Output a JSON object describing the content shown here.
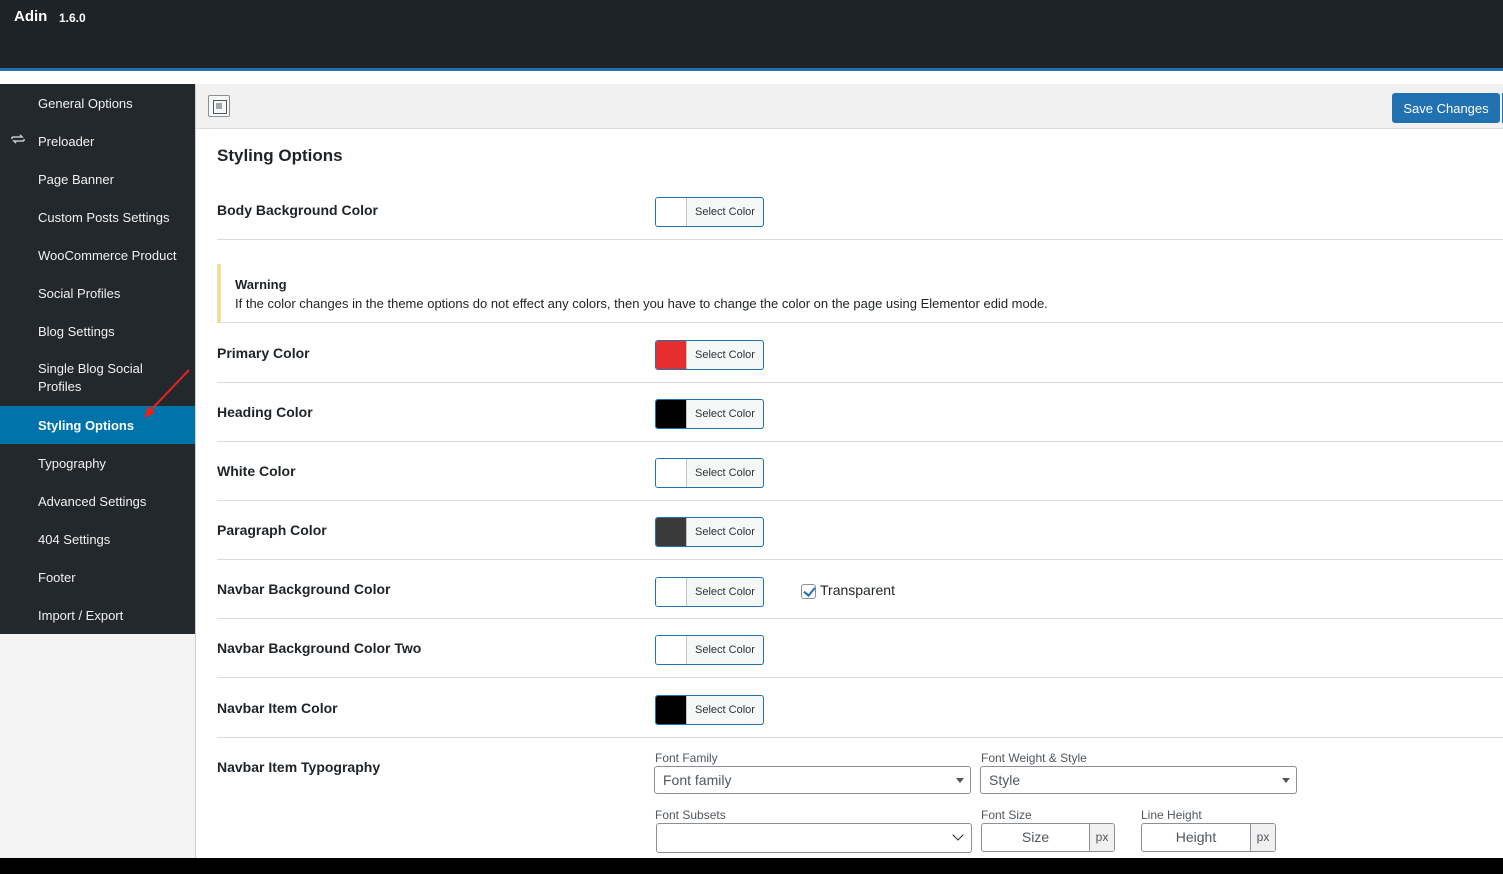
{
  "app": {
    "title": "Adin",
    "version": "1.6.0"
  },
  "sidebar": {
    "items": [
      {
        "label": "General Options",
        "icon": ""
      },
      {
        "label": "Preloader",
        "icon": "repeat-icon"
      },
      {
        "label": "Page Banner",
        "icon": ""
      },
      {
        "label": "Custom Posts Settings",
        "icon": ""
      },
      {
        "label": "WooCommerce Product",
        "icon": ""
      },
      {
        "label": "Social Profiles",
        "icon": ""
      },
      {
        "label": "Blog Settings",
        "icon": ""
      },
      {
        "label": "Single Blog Social Profiles",
        "icon": ""
      },
      {
        "label": "Styling Options",
        "icon": "",
        "active": true
      },
      {
        "label": "Typography",
        "icon": ""
      },
      {
        "label": "Advanced Settings",
        "icon": ""
      },
      {
        "label": "404 Settings",
        "icon": ""
      },
      {
        "label": "Footer",
        "icon": ""
      },
      {
        "label": "Import / Export",
        "icon": ""
      }
    ]
  },
  "toolbar": {
    "save_label": "Save Changes"
  },
  "section": {
    "title": "Styling Options"
  },
  "color_button_label": "Select Color",
  "fields": {
    "body_bg": {
      "label": "Body Background Color",
      "color": "#ffffff"
    },
    "primary": {
      "label": "Primary Color",
      "color": "#e62e2e"
    },
    "heading": {
      "label": "Heading Color",
      "color": "#000000"
    },
    "white": {
      "label": "White Color",
      "color": "#ffffff"
    },
    "paragraph": {
      "label": "Paragraph Color",
      "color": "#3a3a3a"
    },
    "navbar_bg": {
      "label": "Navbar Background Color",
      "color": "#ffffff",
      "checkbox_label": "Transparent",
      "checked": true
    },
    "navbar_bg_two": {
      "label": "Navbar Background Color Two",
      "color": "#ffffff"
    },
    "navbar_item": {
      "label": "Navbar Item Color",
      "color": "#000000"
    },
    "navbar_typo": {
      "label": "Navbar Item Typography",
      "font_family_label": "Font Family",
      "font_family_value": "Font family",
      "font_weight_label": "Font Weight & Style",
      "font_weight_value": "Style",
      "font_subsets_label": "Font Subsets",
      "font_subsets_value": "",
      "font_size_label": "Font Size",
      "font_size_placeholder": "Size",
      "line_height_label": "Line Height",
      "line_height_placeholder": "Height",
      "unit": "px"
    }
  },
  "warning": {
    "title": "Warning",
    "text": "If the color changes in the theme options do not effect any colors, then you have to change the color on the page using Elementor edid mode."
  },
  "colors": {
    "accent": "#2271b1",
    "sidebar_bg": "#23282d",
    "sidebar_active": "#0073aa",
    "annotation_arrow": "#e8231c"
  }
}
